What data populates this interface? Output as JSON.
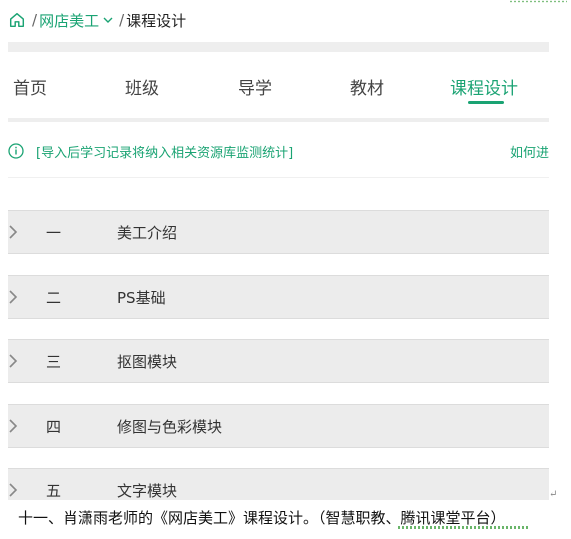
{
  "breadcrumb": {
    "sep1": "/",
    "course": "网店美工",
    "sep2": "/",
    "current": "课程设计"
  },
  "tabs": [
    {
      "label": "首页"
    },
    {
      "label": "班级"
    },
    {
      "label": "导学"
    },
    {
      "label": "教材"
    },
    {
      "label": "课程设计",
      "active": true
    }
  ],
  "notice": {
    "text": "[导入后学习记录将纳入相关资源库监测统计]",
    "link": "如何进"
  },
  "modules": [
    {
      "num": "一",
      "title": "美工介绍"
    },
    {
      "num": "二",
      "title": "PS基础"
    },
    {
      "num": "三",
      "title": "抠图模块"
    },
    {
      "num": "四",
      "title": "修图与色彩模块"
    },
    {
      "num": "五",
      "title": "文字模块"
    }
  ],
  "caption": {
    "text": "十一、肖潇雨老师的《网店美工》课程设计。（智慧职教、腾讯课堂平台）",
    "para_mark": "↵"
  },
  "colors": {
    "accent": "#1aa373",
    "module_bg": "#ececec",
    "divider": "#eeeeee"
  },
  "icons": {
    "home": "home-icon",
    "chevron_down": "chevron-down-icon",
    "info": "info-icon",
    "chevron_right": "chevron-right-icon"
  }
}
